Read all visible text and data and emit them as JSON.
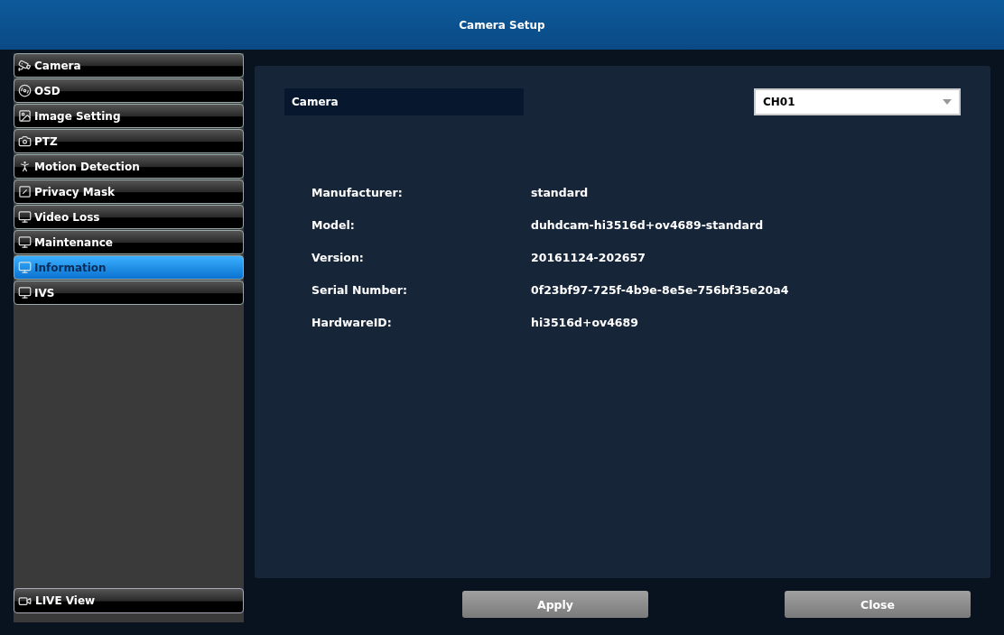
{
  "window": {
    "title": "Camera Setup"
  },
  "sidebar": {
    "items": [
      {
        "label": "Camera",
        "selected": false
      },
      {
        "label": "OSD",
        "selected": false
      },
      {
        "label": "Image Setting",
        "selected": false
      },
      {
        "label": "PTZ",
        "selected": false
      },
      {
        "label": "Motion Detection",
        "selected": false
      },
      {
        "label": "Privacy Mask",
        "selected": false
      },
      {
        "label": "Video Loss",
        "selected": false
      },
      {
        "label": "Maintenance",
        "selected": false
      },
      {
        "label": "Information",
        "selected": true
      },
      {
        "label": "IVS",
        "selected": false
      }
    ],
    "live_view": "LIVE View"
  },
  "camera": {
    "label": "Camera",
    "value": "CH01"
  },
  "info": [
    {
      "label": "Manufacturer:",
      "value": "standard"
    },
    {
      "label": "Model:",
      "value": "duhdcam-hi3516d+ov4689-standard"
    },
    {
      "label": "Version:",
      "value": "20161124-202657"
    },
    {
      "label": "Serial Number:",
      "value": "0f23bf97-725f-4b9e-8e5e-756bf35e20a4"
    },
    {
      "label": "HardwareID:",
      "value": "hi3516d+ov4689"
    }
  ],
  "buttons": [
    "Apply",
    "Close"
  ]
}
